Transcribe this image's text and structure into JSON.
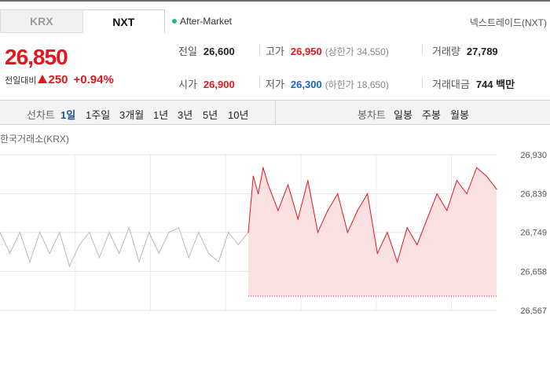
{
  "tabs": [
    {
      "label": "KRX",
      "active": false
    },
    {
      "label": "NXT",
      "active": true
    }
  ],
  "session": "After-Market",
  "exchange_link": "넥스트레이드(NXT)",
  "price": "26,850",
  "change": {
    "label": "전일대비",
    "amount": "250",
    "percent": "+0.94%",
    "direction": "up"
  },
  "stats": {
    "prev_close": {
      "label": "전일",
      "value": "26,600"
    },
    "high": {
      "label": "고가",
      "value": "26,950",
      "sub": "(상한가 34,550)"
    },
    "volume": {
      "label": "거래량",
      "value": "27,789"
    },
    "open": {
      "label": "시가",
      "value": "26,900"
    },
    "low": {
      "label": "저가",
      "value": "26,300",
      "sub": "(하한가 18,650)"
    },
    "turnover": {
      "label": "거래대금",
      "value": "744 백만"
    }
  },
  "period_bar": {
    "line_label": "선차트",
    "line_periods": [
      "1일",
      "1주일",
      "3개월",
      "1년",
      "3년",
      "5년",
      "10년"
    ],
    "active_period": "1일",
    "candle_label": "봉차트",
    "candle_periods": [
      "일봉",
      "주봉",
      "월봉"
    ]
  },
  "chart_title": "한국거래소(KRX)",
  "chart_data": {
    "type": "line",
    "ylim": [
      26567,
      26930
    ],
    "yticks": [
      26930,
      26839,
      26749,
      26658,
      26567
    ],
    "ytick_labels": [
      "26,930",
      "26,839",
      "26,749",
      "26,658",
      "26,567"
    ],
    "baseline": 26600,
    "series": [
      {
        "color": "#b9b9b9",
        "x": [
          0,
          0.02,
          0.04,
          0.06,
          0.08,
          0.1,
          0.12,
          0.14,
          0.16,
          0.18,
          0.2,
          0.22,
          0.24,
          0.26,
          0.28,
          0.3,
          0.32,
          0.34,
          0.36,
          0.38,
          0.4,
          0.42,
          0.44,
          0.46,
          0.48,
          0.5
        ],
        "values": [
          26749,
          26700,
          26749,
          26680,
          26749,
          26700,
          26749,
          26670,
          26720,
          26749,
          26690,
          26749,
          26700,
          26760,
          26680,
          26749,
          26700,
          26749,
          26760,
          26690,
          26749,
          26700,
          26680,
          26749,
          26720,
          26749
        ]
      },
      {
        "color": "#e3171c",
        "fill": "#fbe0e2",
        "x": [
          0.5,
          0.51,
          0.52,
          0.53,
          0.54,
          0.56,
          0.58,
          0.6,
          0.62,
          0.64,
          0.66,
          0.68,
          0.7,
          0.72,
          0.74,
          0.76,
          0.78,
          0.8,
          0.82,
          0.84,
          0.86,
          0.88,
          0.9,
          0.92,
          0.94,
          0.96,
          0.98,
          1.0
        ],
        "values": [
          26749,
          26880,
          26839,
          26900,
          26860,
          26800,
          26860,
          26780,
          26870,
          26749,
          26800,
          26839,
          26749,
          26800,
          26839,
          26700,
          26749,
          26680,
          26760,
          26720,
          26780,
          26839,
          26800,
          26870,
          26839,
          26900,
          26880,
          26850
        ]
      }
    ]
  }
}
